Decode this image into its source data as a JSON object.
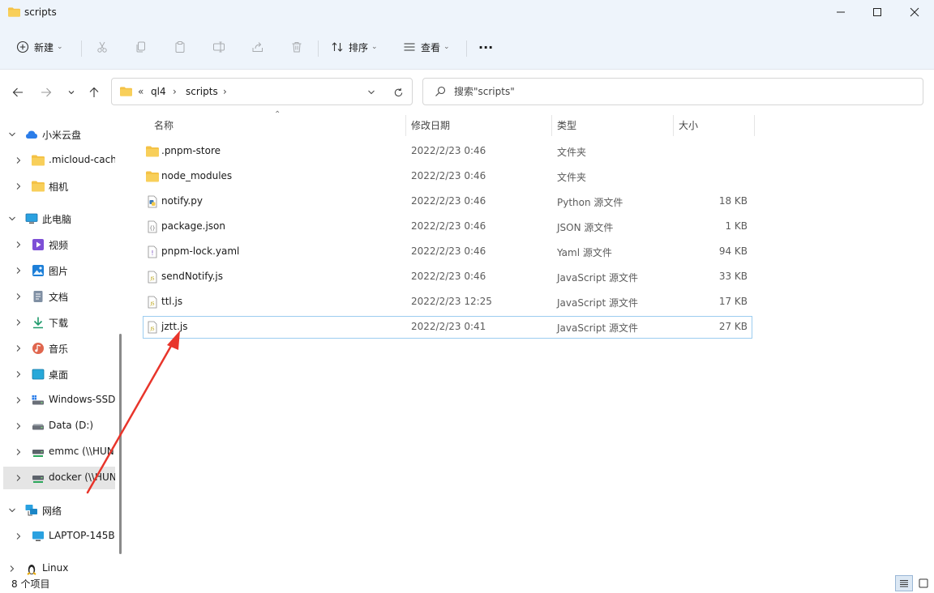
{
  "window": {
    "title": "scripts"
  },
  "toolbar": {
    "new_label": "新建",
    "sort_label": "排序",
    "view_label": "查看",
    "more_label": "···"
  },
  "address": {
    "overflow": "«",
    "crumbs": [
      "ql4",
      "scripts"
    ]
  },
  "search": {
    "placeholder": "搜索\"scripts\""
  },
  "sidebar": {
    "items": [
      {
        "label": "小米云盘",
        "icon": "cloud-icon",
        "expanded": true,
        "level": 0
      },
      {
        "label": ".micloud-cach",
        "icon": "folder-icon",
        "level": 1
      },
      {
        "label": "相机",
        "icon": "folder-icon",
        "level": 1
      },
      {
        "label": "此电脑",
        "icon": "computer-icon",
        "expanded": true,
        "level": 0
      },
      {
        "label": "视频",
        "icon": "video-icon",
        "level": 1
      },
      {
        "label": "图片",
        "icon": "pictures-icon",
        "level": 1
      },
      {
        "label": "文档",
        "icon": "documents-icon",
        "level": 1
      },
      {
        "label": "下载",
        "icon": "download-icon",
        "level": 1
      },
      {
        "label": "音乐",
        "icon": "music-icon",
        "level": 1
      },
      {
        "label": "桌面",
        "icon": "desktop-icon",
        "level": 1
      },
      {
        "label": "Windows-SSD",
        "icon": "drive-icon",
        "level": 1
      },
      {
        "label": "Data (D:)",
        "icon": "drive-icon",
        "level": 1
      },
      {
        "label": "emmc (\\\\HUN",
        "icon": "network-drive-icon",
        "level": 1
      },
      {
        "label": "docker (\\\\HUN",
        "icon": "network-drive-icon",
        "level": 1,
        "selected": true
      },
      {
        "label": "网络",
        "icon": "network-icon",
        "expanded": true,
        "level": 0
      },
      {
        "label": "LAPTOP-145B",
        "icon": "computer-icon",
        "level": 1
      },
      {
        "label": "Linux",
        "icon": "linux-icon",
        "level": 0
      }
    ]
  },
  "columns": {
    "name": "名称",
    "modified": "修改日期",
    "type": "类型",
    "size": "大小"
  },
  "files": [
    {
      "name": ".pnpm-store",
      "modified": "2022/2/23 0:46",
      "type": "文件夹",
      "size": "",
      "icon": "folder-icon"
    },
    {
      "name": "node_modules",
      "modified": "2022/2/23 0:46",
      "type": "文件夹",
      "size": "",
      "icon": "folder-icon"
    },
    {
      "name": "notify.py",
      "modified": "2022/2/23 0:46",
      "type": "Python 源文件",
      "size": "18 KB",
      "icon": "python-file-icon"
    },
    {
      "name": "package.json",
      "modified": "2022/2/23 0:46",
      "type": "JSON 源文件",
      "size": "1 KB",
      "icon": "json-file-icon"
    },
    {
      "name": "pnpm-lock.yaml",
      "modified": "2022/2/23 0:46",
      "type": "Yaml 源文件",
      "size": "94 KB",
      "icon": "yaml-file-icon"
    },
    {
      "name": "sendNotify.js",
      "modified": "2022/2/23 0:46",
      "type": "JavaScript 源文件",
      "size": "33 KB",
      "icon": "js-file-icon"
    },
    {
      "name": "ttl.js",
      "modified": "2022/2/23 12:25",
      "type": "JavaScript 源文件",
      "size": "17 KB",
      "icon": "js-file-icon"
    },
    {
      "name": "jztt.js",
      "modified": "2022/2/23 0:41",
      "type": "JavaScript 源文件",
      "size": "27 KB",
      "icon": "js-file-icon",
      "selected": true
    }
  ],
  "status": {
    "item_count": "8 个项目"
  },
  "colors": {
    "topband": "#eef4fb",
    "folder": "#f4c246",
    "selection_border": "#9ccdf0",
    "annotation_arrow": "#e8352b"
  }
}
